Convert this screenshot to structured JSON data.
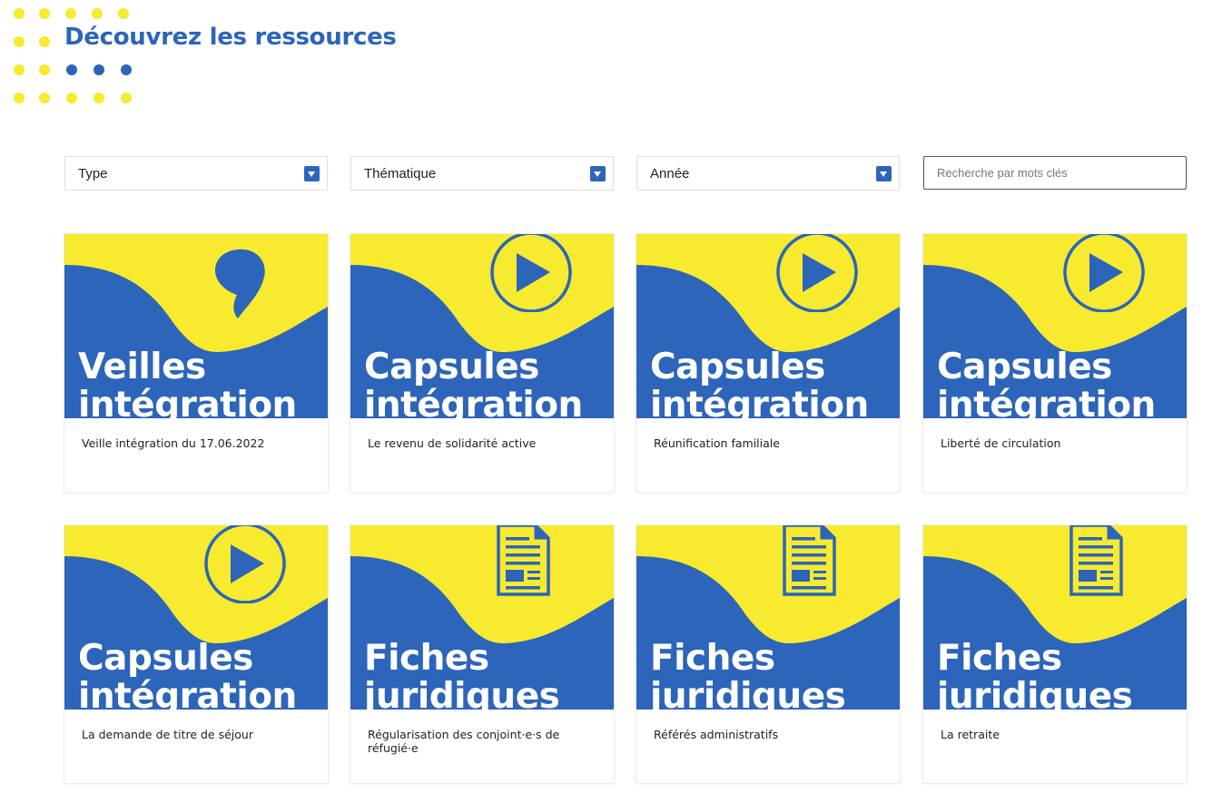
{
  "header": {
    "title": "Découvrez les ressources"
  },
  "filters": {
    "type_label": "Type",
    "theme_label": "Thématique",
    "year_label": "Année",
    "search_placeholder": "Recherche par mots clés",
    "search_value": ""
  },
  "colors": {
    "brand_blue": "#2c65b9",
    "brand_yellow": "#f7ea2f"
  },
  "cards": [
    {
      "category_line1": "Veilles",
      "category_line2": "intégration",
      "icon": "quote-icon",
      "title": "Veille intégration du 17.06.2022"
    },
    {
      "category_line1": "Capsules",
      "category_line2": "intégration",
      "icon": "play-icon",
      "title": "Le revenu de solidarité active"
    },
    {
      "category_line1": "Capsules",
      "category_line2": "intégration",
      "icon": "play-icon",
      "title": "Réunification familiale"
    },
    {
      "category_line1": "Capsules",
      "category_line2": "intégration",
      "icon": "play-icon",
      "title": "Liberté de circulation"
    },
    {
      "category_line1": "Capsules",
      "category_line2": "intégration",
      "icon": "play-icon",
      "title": "La demande de titre de séjour"
    },
    {
      "category_line1": "Fiches",
      "category_line2": "juridiques",
      "icon": "document-icon",
      "title": "Régularisation des conjoint·e·s de réfugié·e"
    },
    {
      "category_line1": "Fiches",
      "category_line2": "juridiques",
      "icon": "document-icon",
      "title": "Référés administratifs"
    },
    {
      "category_line1": "Fiches",
      "category_line2": "juridiques",
      "icon": "document-icon",
      "title": "La retraite"
    }
  ]
}
